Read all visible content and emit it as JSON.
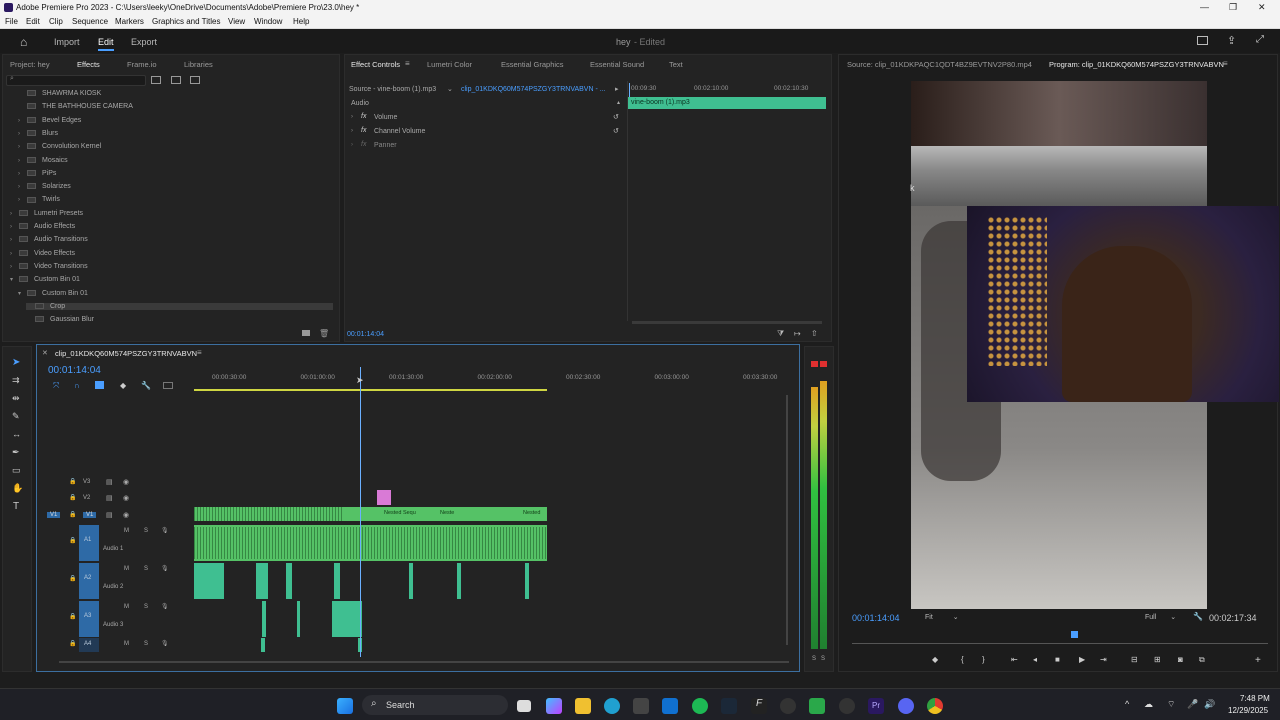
{
  "window": {
    "title": "Adobe Premiere Pro 2023 - C:\\Users\\leeky\\OneDrive\\Documents\\Adobe\\Premiere Pro\\23.0\\hey *"
  },
  "menu": [
    "File",
    "Edit",
    "Clip",
    "Sequence",
    "Markers",
    "Graphics and Titles",
    "View",
    "Window",
    "Help"
  ],
  "appbar": {
    "import": "Import",
    "edit": "Edit",
    "export": "Export",
    "project": "hey",
    "status": "- Edited"
  },
  "effects_panel": {
    "tabs": [
      "Project: hey",
      "Effects",
      "Frame.io",
      "Libraries"
    ],
    "items": [
      {
        "label": "SHAWRMA KIOSK",
        "indent": 1,
        "type": "preset"
      },
      {
        "label": "THE BATHHOUSE CAMERA",
        "indent": 1,
        "type": "preset"
      },
      {
        "label": "Bevel Edges",
        "indent": 1,
        "type": "folder"
      },
      {
        "label": "Blurs",
        "indent": 1,
        "type": "folder"
      },
      {
        "label": "Convolution Kernel",
        "indent": 1,
        "type": "folder"
      },
      {
        "label": "Mosaics",
        "indent": 1,
        "type": "folder"
      },
      {
        "label": "PiPs",
        "indent": 1,
        "type": "folder"
      },
      {
        "label": "Solarizes",
        "indent": 1,
        "type": "folder"
      },
      {
        "label": "Twirls",
        "indent": 1,
        "type": "folder"
      },
      {
        "label": "Lumetri Presets",
        "indent": 0,
        "type": "folder"
      },
      {
        "label": "Audio Effects",
        "indent": 0,
        "type": "folder"
      },
      {
        "label": "Audio Transitions",
        "indent": 0,
        "type": "folder"
      },
      {
        "label": "Video Effects",
        "indent": 0,
        "type": "folder"
      },
      {
        "label": "Video Transitions",
        "indent": 0,
        "type": "folder"
      },
      {
        "label": "Custom Bin 01",
        "indent": 0,
        "type": "folder"
      },
      {
        "label": "Custom Bin 01",
        "indent": 1,
        "type": "folder"
      },
      {
        "label": "Crop",
        "indent": 2,
        "type": "effect"
      },
      {
        "label": "Gaussian Blur",
        "indent": 2,
        "type": "effect"
      }
    ]
  },
  "effect_controls": {
    "tabs": [
      "Effect Controls",
      "Lumetri Color",
      "Essential Graphics",
      "Essential Sound",
      "Text"
    ],
    "source": "Source - vine-boom (1).mp3",
    "clip": "clip_01KDKQ60M574PSZGY3TRNVABVN - ...",
    "section": "Audio",
    "effects": [
      "Volume",
      "Channel Volume",
      "Panner"
    ],
    "ruler": [
      "00:09:30",
      "00:02:10:00",
      "00:02:10:30"
    ],
    "clip_bar": "vine-boom (1).mp3",
    "timecode": "00:01:14:04"
  },
  "source_monitor": {
    "tab": "Source: clip_01KDKPAQC1QDT4BZ9EVTNV2P80.mp4",
    "program_tab": "Program: clip_01KDKQ60M574PSZGY3TRNVABVN"
  },
  "program": {
    "timecode": "00:01:14:04",
    "fit": "Fit",
    "resolution": "Full",
    "duration": "00:02:17:34",
    "side_letter": "k"
  },
  "timeline": {
    "tab": "clip_01KDKQ60M574PSZGY3TRNVABVN",
    "timecode": "00:01:14:04",
    "ruler": [
      "00:00:30:00",
      "00:01:00:00",
      "00:01:30:00",
      "00:02:00:00",
      "00:02:30:00",
      "00:03:00:00",
      "00:03:30:00"
    ],
    "video_tracks": [
      "V3",
      "V2",
      "V1"
    ],
    "audio_tracks": [
      {
        "id": "A1",
        "name": "Audio 1"
      },
      {
        "id": "A2",
        "name": "Audio 2"
      },
      {
        "id": "A3",
        "name": "Audio 3"
      },
      {
        "id": "A4",
        "name": ""
      }
    ],
    "nested_labels": [
      "Nested Sequ",
      "Neste",
      "Nested"
    ],
    "meter_labels": [
      "S",
      "S"
    ]
  },
  "taskbar": {
    "search": "Search",
    "time": "7:48 PM",
    "date": "12/29/2025"
  },
  "colors": {
    "accent": "#4a9eff",
    "clip_green": "#55c266",
    "clip_teal": "#3fbf91",
    "clip_pink": "#d97ad6",
    "playhead": "#6bb0ff"
  }
}
